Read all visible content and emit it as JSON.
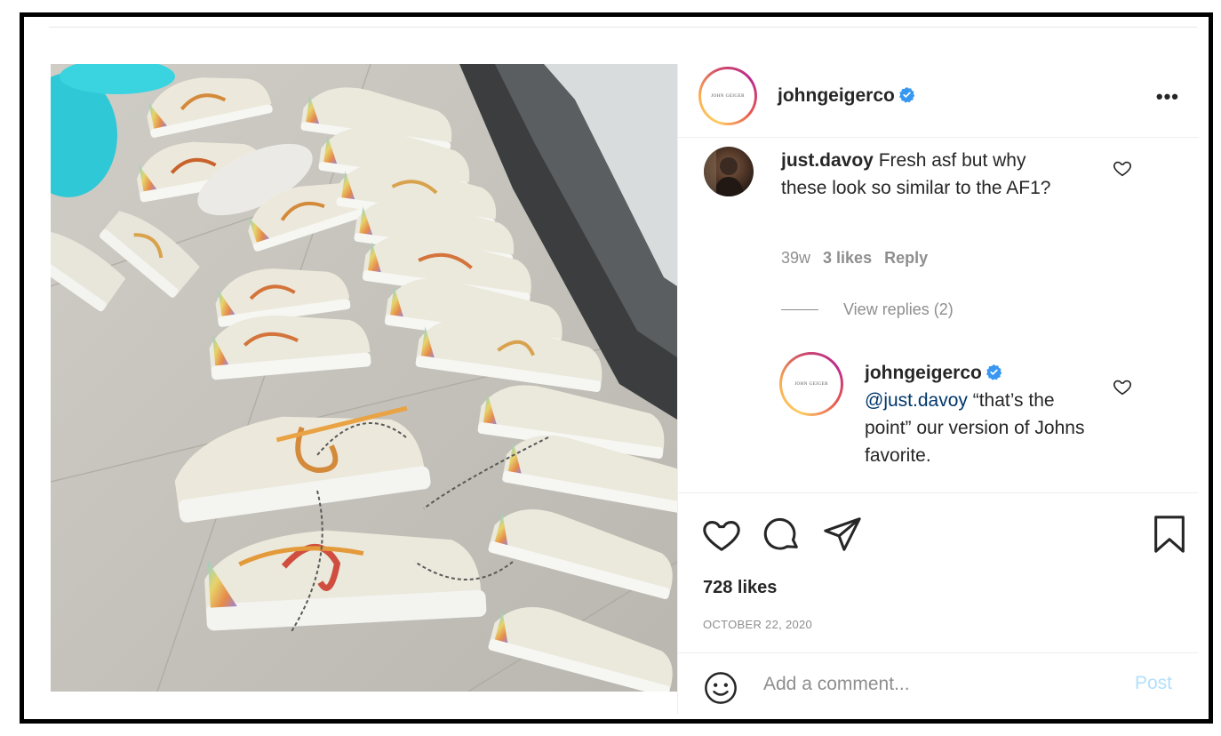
{
  "post": {
    "username": "johngeigerco",
    "verified": true,
    "more_label": "•••",
    "logo_text": "JOHN GEIGER",
    "likes": "728 likes",
    "date": "OCTOBER 22, 2020",
    "image_icon": "sneakers-photo"
  },
  "comments": [
    {
      "username": "just.davoy",
      "text": "Fresh asf but why these look so similar to the AF1?",
      "age": "39w",
      "likes": "3 likes",
      "reply_label": "Reply",
      "view_replies": "View replies (2)"
    }
  ],
  "reply": {
    "username": "johngeigerco",
    "mention": "@just.davoy",
    "text": "“that’s the point” our version of Johns favorite."
  },
  "add_comment": {
    "placeholder": "Add a comment...",
    "post_label": "Post"
  },
  "icons": {
    "like": "heart-icon",
    "comment": "comment-icon",
    "share": "send-icon",
    "save": "bookmark-icon",
    "emoji": "smile-icon",
    "verified": "verified-badge-icon",
    "more": "more-options-icon"
  },
  "colors": {
    "verified_blue": "#3897f0",
    "mention_blue": "#00376b",
    "post_disabled": "#b2dffc",
    "muted_text": "#8e8e8e"
  }
}
